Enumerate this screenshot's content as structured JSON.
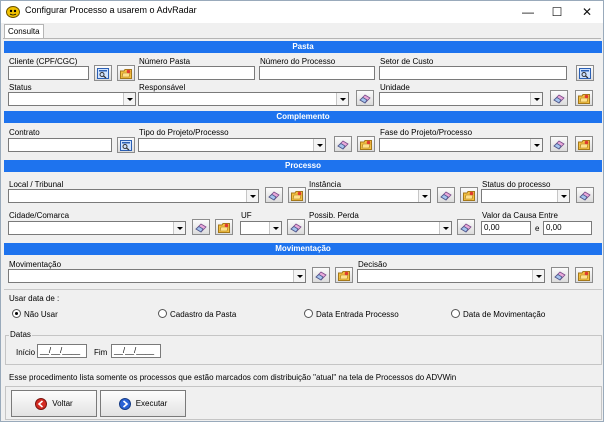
{
  "window": {
    "title": "Configurar Processo a usarem o AdvRadar",
    "min_glyph": "—",
    "max_glyph": "☐",
    "close_glyph": "✕"
  },
  "tab": {
    "label": "Consulta"
  },
  "sections": {
    "pasta": "Pasta",
    "complemento": "Complemento",
    "processo": "Processo",
    "movimentacao": "Movimentação"
  },
  "pasta": {
    "cliente_label": "Cliente (CPF/CGC)",
    "numero_pasta_label": "Número Pasta",
    "numero_processo_label": "Número do Processo",
    "setor_label": "Setor de Custo",
    "status_label": "Status",
    "responsavel_label": "Responsável",
    "unidade_label": "Unidade"
  },
  "complemento": {
    "contrato_label": "Contrato",
    "tipo_label": "Tipo do Projeto/Processo",
    "fase_label": "Fase do Projeto/Processo"
  },
  "processo": {
    "local_label": "Local / Tribunal",
    "instancia_label": "Instância",
    "status_label": "Status do processo",
    "cidade_label": "Cidade/Comarca",
    "uf_label": "UF",
    "perda_label": "Possib. Perda",
    "valor_label": "Valor da Causa Entre",
    "valor_min": "0,00",
    "valor_e": "e",
    "valor_max": "0,00"
  },
  "movimentacao": {
    "movimentacao_label": "Movimentação",
    "decisao_label": "Decisão"
  },
  "usar_data": {
    "legend": "Usar data de :",
    "options": [
      "Não Usar",
      "Cadastro da Pasta",
      "Data Entrada Processo",
      "Data de Movimentação"
    ],
    "selected": "Não Usar"
  },
  "datas": {
    "legend": "Datas",
    "inicio_label": "Início",
    "inicio_value": "__/__/____",
    "fim_label": "Fim",
    "fim_value": "__/__/____"
  },
  "info_text": "Esse procedimento lista somente os processos que estão marcados com distribuição \"atual\" na tela de Processos do ADVWin",
  "buttons": {
    "voltar": "Voltar",
    "executar": "Executar"
  },
  "colors": {
    "section_header": "#1e73ee",
    "window_bg": "#f0f0f0"
  }
}
